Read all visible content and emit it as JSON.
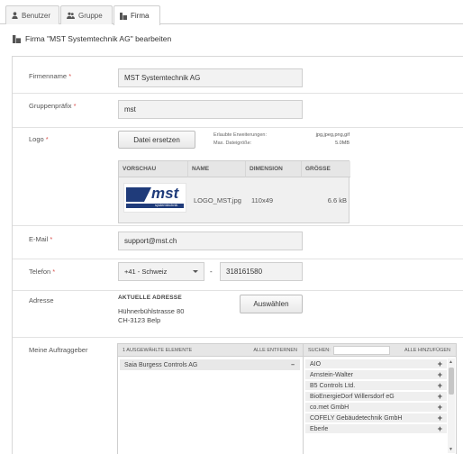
{
  "tabs": [
    {
      "label": "Benutzer",
      "icon": "user-icon"
    },
    {
      "label": "Gruppe",
      "icon": "users-icon"
    },
    {
      "label": "Firma",
      "icon": "building-icon",
      "active": true
    }
  ],
  "page": {
    "title": "Firma \"MST Systemtechnik AG\" bearbeiten"
  },
  "form": {
    "firmenname": {
      "label": "Firmenname",
      "value": "MST Systemtechnik AG"
    },
    "gruppenprefix": {
      "label": "Gruppenpräfix",
      "value": "mst"
    },
    "logo": {
      "label": "Logo",
      "replace_button": "Datei ersetzen",
      "allowed_ext_label": "Erlaubte Erweiterungen:",
      "allowed_ext_value": "jpg,jpeg,png,gif",
      "max_size_label": "Max. Dateigröße:",
      "max_size_value": "5.0MB",
      "table": {
        "headers": [
          "VORSCHAU",
          "NAME",
          "DIMENSION",
          "GRÖSSE"
        ],
        "row": {
          "name": "LOGO_MST.jpg",
          "dimension": "110x49",
          "size": "6.6 kB"
        },
        "logo_text": "mst",
        "logo_sub": "systemtechnik"
      }
    },
    "email": {
      "label": "E-Mail",
      "value": "support@mst.ch"
    },
    "telefon": {
      "label": "Telefon",
      "country": "+41 - Schweiz",
      "separator": "-",
      "number": "318161580"
    },
    "adresse": {
      "label": "Adresse",
      "heading": "AKTUELLE ADRESSE",
      "line1": "Hühnerbühlstrasse 80",
      "line2": "CH-3123 Belp",
      "button": "Auswählen"
    },
    "auftraggeber": {
      "label": "Meine Auftraggeber",
      "selected_header": "1 AUSGEWÄHLTE ELEMENTE",
      "remove_all": "ALLE ENTFERNEN",
      "selected": [
        "Saia Burgess Controls AG"
      ],
      "search_label": "SUCHEN:",
      "add_all": "ALLE HINZUFÜGEN",
      "available": [
        "AIO",
        "Arnstein-Walter",
        "B5 Controls Ltd.",
        "BioEnergieDorf Willersdorf eG",
        "co.met GmbH",
        "COFELY Gebäudetechnik GmbH",
        "Eberle"
      ]
    }
  },
  "colors": {
    "required": "#d9534f",
    "tab_border": "#cfcfcf",
    "input_bg": "#f2f2f2"
  }
}
